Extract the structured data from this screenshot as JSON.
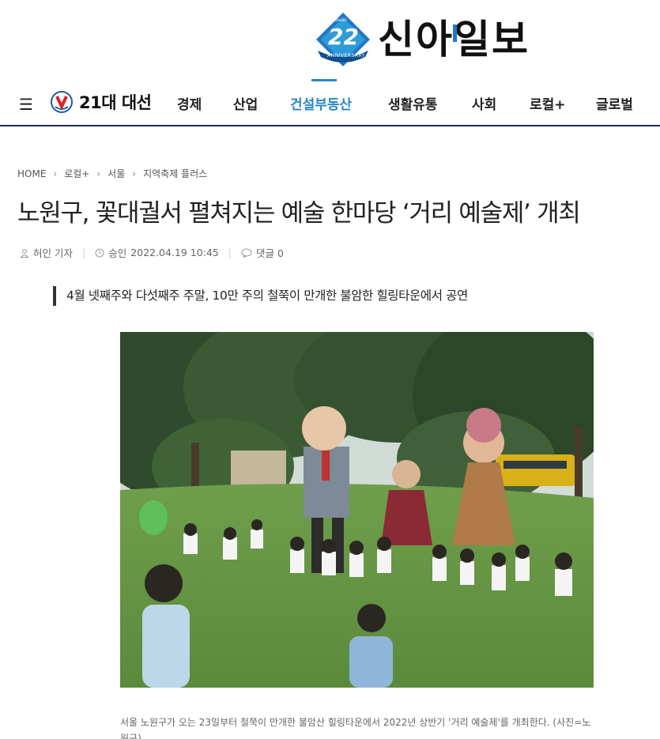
{
  "header": {
    "anniversary_number": "22",
    "anniversary_label": "ANNIVERSARY",
    "anniversary_sub": "SINAILBO",
    "brand_name": "신아일보"
  },
  "nav": {
    "election_label": "21대 대선",
    "items": [
      "경제",
      "산업",
      "건설부동산",
      "생활유통",
      "사회",
      "로컬+",
      "글로벌"
    ],
    "active_item": "건설부동산"
  },
  "article": {
    "breadcrumb": [
      "HOME",
      "로컬+",
      "서울",
      "지역축제 플러스"
    ],
    "title": "노원구, 꽃대궐서 펼쳐지는 예술 한마당 ‘거리 예술제’ 개최",
    "author": "허인 기자",
    "approved_label": "승인",
    "approved_date": "2022.04.19 10:45",
    "comments_label": "댓글 0",
    "subtitle": "4월 넷째주와 다섯째주 주말, 10만 주의 철쭉이 만개한 불암한 힐링타운에서 공연",
    "caption": "서울 노원구가 오는 23일부터 철쭉이 만개한 불암산 힐링타운에서 2022년 상반기 '거리 예술제'를 개최한다. (사진=노원구)"
  },
  "colors": {
    "accent": "#2a87c8",
    "nav_border": "#1d2b55",
    "brand_logo_blue": "#1f77c4"
  }
}
